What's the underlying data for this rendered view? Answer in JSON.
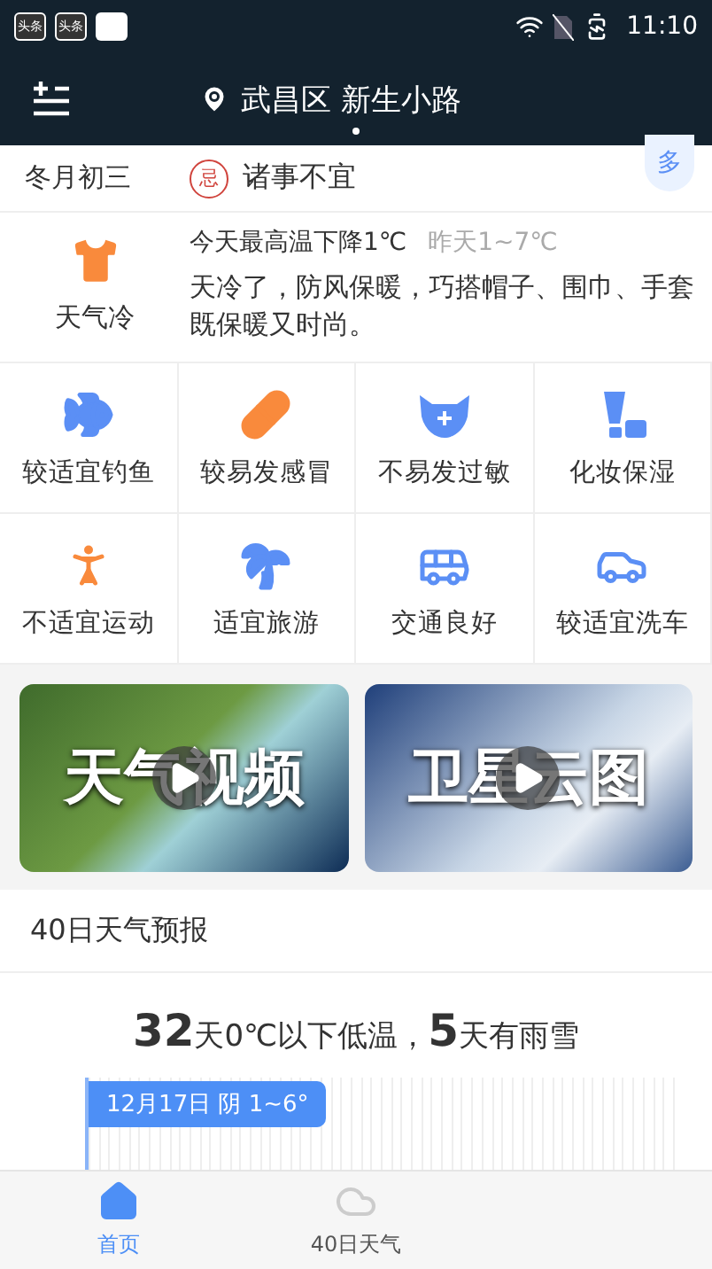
{
  "status_bar": {
    "app_badges": [
      "头条",
      "头条"
    ],
    "time": "11:10"
  },
  "header": {
    "location": "武昌区 新生小路",
    "page_dots": [
      {
        "selected": true
      }
    ]
  },
  "almanac": {
    "lunar_date": "冬月初三",
    "avoid_mark": "忌",
    "avoid_text": "诸事不宜",
    "more_button": "多"
  },
  "dressing": {
    "label": "天气冷",
    "headline": "今天最高温下降1℃",
    "yesterday": "昨天1~7℃",
    "advice": "天冷了，防风保暖，巧搭帽子、围巾、手套既保暖又时尚。"
  },
  "indices": [
    {
      "label": "较适宜钓鱼",
      "color": "#5b8ff5"
    },
    {
      "label": "较易发感冒",
      "color": "#f98a3c"
    },
    {
      "label": "不易发过敏",
      "color": "#5b8ff5"
    },
    {
      "label": "化妆保湿",
      "color": "#5b8ff5"
    },
    {
      "label": "不适宜运动",
      "color": "#f98a3c"
    },
    {
      "label": "适宜旅游",
      "color": "#5b8ff5"
    },
    {
      "label": "交通良好",
      "color": "#5b8ff5"
    },
    {
      "label": "较适宜洗车",
      "color": "#5b8ff5"
    }
  ],
  "videos": [
    {
      "title": "天气视频"
    },
    {
      "title": "卫星云图"
    }
  ],
  "forecast40": {
    "title": "40日天气预报",
    "summary": "**32**天0℃以下低温，**5**天有雨雪",
    "tooltip": "12月17日 阴 1~6°"
  },
  "bottom_nav": [
    {
      "label": "首页",
      "selected": true
    },
    {
      "label": "40日天气",
      "selected": false
    }
  ]
}
